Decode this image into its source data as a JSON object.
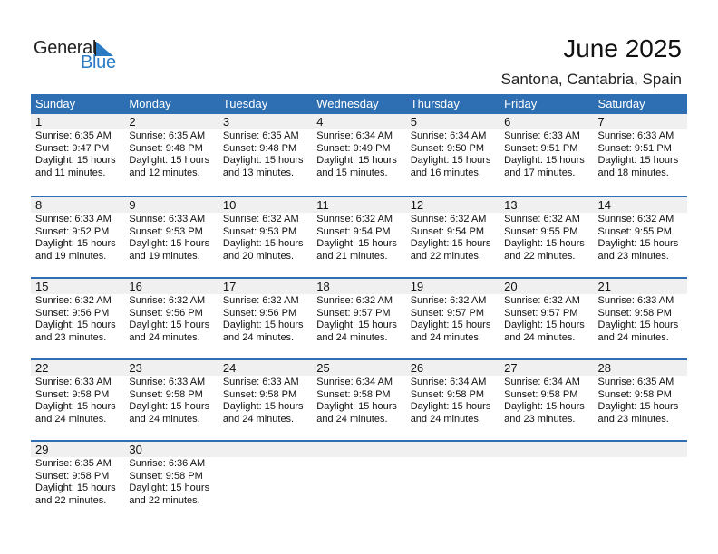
{
  "logo": {
    "general": "General",
    "blue": "Blue"
  },
  "header": {
    "title": "June 2025",
    "location": "Santona, Cantabria, Spain"
  },
  "colors": {
    "accent": "#2e6fb3",
    "logo_blue": "#2a7bc4",
    "date_strip": "#f0f0f0"
  },
  "weekdays": [
    "Sunday",
    "Monday",
    "Tuesday",
    "Wednesday",
    "Thursday",
    "Friday",
    "Saturday"
  ],
  "weeks": [
    [
      {
        "day": "1",
        "sunrise": "Sunrise: 6:35 AM",
        "sunset": "Sunset: 9:47 PM",
        "daylight1": "Daylight: 15 hours",
        "daylight2": "and 11 minutes."
      },
      {
        "day": "2",
        "sunrise": "Sunrise: 6:35 AM",
        "sunset": "Sunset: 9:48 PM",
        "daylight1": "Daylight: 15 hours",
        "daylight2": "and 12 minutes."
      },
      {
        "day": "3",
        "sunrise": "Sunrise: 6:35 AM",
        "sunset": "Sunset: 9:48 PM",
        "daylight1": "Daylight: 15 hours",
        "daylight2": "and 13 minutes."
      },
      {
        "day": "4",
        "sunrise": "Sunrise: 6:34 AM",
        "sunset": "Sunset: 9:49 PM",
        "daylight1": "Daylight: 15 hours",
        "daylight2": "and 15 minutes."
      },
      {
        "day": "5",
        "sunrise": "Sunrise: 6:34 AM",
        "sunset": "Sunset: 9:50 PM",
        "daylight1": "Daylight: 15 hours",
        "daylight2": "and 16 minutes."
      },
      {
        "day": "6",
        "sunrise": "Sunrise: 6:33 AM",
        "sunset": "Sunset: 9:51 PM",
        "daylight1": "Daylight: 15 hours",
        "daylight2": "and 17 minutes."
      },
      {
        "day": "7",
        "sunrise": "Sunrise: 6:33 AM",
        "sunset": "Sunset: 9:51 PM",
        "daylight1": "Daylight: 15 hours",
        "daylight2": "and 18 minutes."
      }
    ],
    [
      {
        "day": "8",
        "sunrise": "Sunrise: 6:33 AM",
        "sunset": "Sunset: 9:52 PM",
        "daylight1": "Daylight: 15 hours",
        "daylight2": "and 19 minutes."
      },
      {
        "day": "9",
        "sunrise": "Sunrise: 6:33 AM",
        "sunset": "Sunset: 9:53 PM",
        "daylight1": "Daylight: 15 hours",
        "daylight2": "and 19 minutes."
      },
      {
        "day": "10",
        "sunrise": "Sunrise: 6:32 AM",
        "sunset": "Sunset: 9:53 PM",
        "daylight1": "Daylight: 15 hours",
        "daylight2": "and 20 minutes."
      },
      {
        "day": "11",
        "sunrise": "Sunrise: 6:32 AM",
        "sunset": "Sunset: 9:54 PM",
        "daylight1": "Daylight: 15 hours",
        "daylight2": "and 21 minutes."
      },
      {
        "day": "12",
        "sunrise": "Sunrise: 6:32 AM",
        "sunset": "Sunset: 9:54 PM",
        "daylight1": "Daylight: 15 hours",
        "daylight2": "and 22 minutes."
      },
      {
        "day": "13",
        "sunrise": "Sunrise: 6:32 AM",
        "sunset": "Sunset: 9:55 PM",
        "daylight1": "Daylight: 15 hours",
        "daylight2": "and 22 minutes."
      },
      {
        "day": "14",
        "sunrise": "Sunrise: 6:32 AM",
        "sunset": "Sunset: 9:55 PM",
        "daylight1": "Daylight: 15 hours",
        "daylight2": "and 23 minutes."
      }
    ],
    [
      {
        "day": "15",
        "sunrise": "Sunrise: 6:32 AM",
        "sunset": "Sunset: 9:56 PM",
        "daylight1": "Daylight: 15 hours",
        "daylight2": "and 23 minutes."
      },
      {
        "day": "16",
        "sunrise": "Sunrise: 6:32 AM",
        "sunset": "Sunset: 9:56 PM",
        "daylight1": "Daylight: 15 hours",
        "daylight2": "and 24 minutes."
      },
      {
        "day": "17",
        "sunrise": "Sunrise: 6:32 AM",
        "sunset": "Sunset: 9:56 PM",
        "daylight1": "Daylight: 15 hours",
        "daylight2": "and 24 minutes."
      },
      {
        "day": "18",
        "sunrise": "Sunrise: 6:32 AM",
        "sunset": "Sunset: 9:57 PM",
        "daylight1": "Daylight: 15 hours",
        "daylight2": "and 24 minutes."
      },
      {
        "day": "19",
        "sunrise": "Sunrise: 6:32 AM",
        "sunset": "Sunset: 9:57 PM",
        "daylight1": "Daylight: 15 hours",
        "daylight2": "and 24 minutes."
      },
      {
        "day": "20",
        "sunrise": "Sunrise: 6:32 AM",
        "sunset": "Sunset: 9:57 PM",
        "daylight1": "Daylight: 15 hours",
        "daylight2": "and 24 minutes."
      },
      {
        "day": "21",
        "sunrise": "Sunrise: 6:33 AM",
        "sunset": "Sunset: 9:58 PM",
        "daylight1": "Daylight: 15 hours",
        "daylight2": "and 24 minutes."
      }
    ],
    [
      {
        "day": "22",
        "sunrise": "Sunrise: 6:33 AM",
        "sunset": "Sunset: 9:58 PM",
        "daylight1": "Daylight: 15 hours",
        "daylight2": "and 24 minutes."
      },
      {
        "day": "23",
        "sunrise": "Sunrise: 6:33 AM",
        "sunset": "Sunset: 9:58 PM",
        "daylight1": "Daylight: 15 hours",
        "daylight2": "and 24 minutes."
      },
      {
        "day": "24",
        "sunrise": "Sunrise: 6:33 AM",
        "sunset": "Sunset: 9:58 PM",
        "daylight1": "Daylight: 15 hours",
        "daylight2": "and 24 minutes."
      },
      {
        "day": "25",
        "sunrise": "Sunrise: 6:34 AM",
        "sunset": "Sunset: 9:58 PM",
        "daylight1": "Daylight: 15 hours",
        "daylight2": "and 24 minutes."
      },
      {
        "day": "26",
        "sunrise": "Sunrise: 6:34 AM",
        "sunset": "Sunset: 9:58 PM",
        "daylight1": "Daylight: 15 hours",
        "daylight2": "and 24 minutes."
      },
      {
        "day": "27",
        "sunrise": "Sunrise: 6:34 AM",
        "sunset": "Sunset: 9:58 PM",
        "daylight1": "Daylight: 15 hours",
        "daylight2": "and 23 minutes."
      },
      {
        "day": "28",
        "sunrise": "Sunrise: 6:35 AM",
        "sunset": "Sunset: 9:58 PM",
        "daylight1": "Daylight: 15 hours",
        "daylight2": "and 23 minutes."
      }
    ],
    [
      {
        "day": "29",
        "sunrise": "Sunrise: 6:35 AM",
        "sunset": "Sunset: 9:58 PM",
        "daylight1": "Daylight: 15 hours",
        "daylight2": "and 22 minutes."
      },
      {
        "day": "30",
        "sunrise": "Sunrise: 6:36 AM",
        "sunset": "Sunset: 9:58 PM",
        "daylight1": "Daylight: 15 hours",
        "daylight2": "and 22 minutes."
      },
      null,
      null,
      null,
      null,
      null
    ]
  ]
}
